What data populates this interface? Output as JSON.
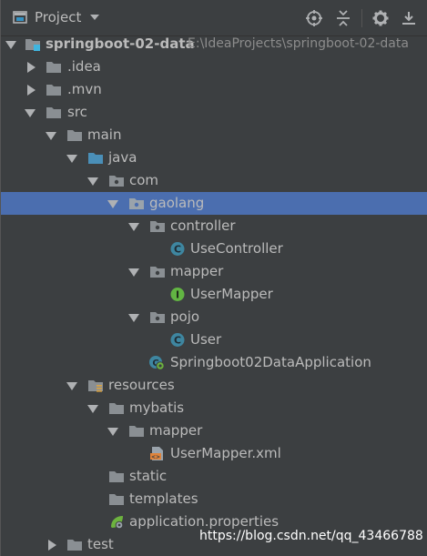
{
  "header": {
    "title": "Project",
    "tools": [
      "locate-icon",
      "collapse-icon",
      "gear-icon",
      "hide-icon"
    ]
  },
  "tree": [
    {
      "name": "project-root",
      "label": "springboot-02-data",
      "path": "E:\\IdeaProjects\\springboot-02-data",
      "expanded": true,
      "icon": "module-folder-icon"
    },
    {
      "name": "folder-idea",
      "label": ".idea",
      "expanded": false,
      "icon": "folder-icon"
    },
    {
      "name": "folder-mvn",
      "label": ".mvn",
      "expanded": false,
      "icon": "folder-icon"
    },
    {
      "name": "folder-src",
      "label": "src",
      "expanded": true,
      "icon": "folder-icon"
    },
    {
      "name": "folder-main",
      "label": "main",
      "expanded": true,
      "icon": "folder-icon"
    },
    {
      "name": "folder-java",
      "label": "java",
      "expanded": true,
      "icon": "source-folder-icon"
    },
    {
      "name": "package-com",
      "label": "com",
      "expanded": true,
      "icon": "package-icon"
    },
    {
      "name": "package-gaolang",
      "label": "gaolang",
      "expanded": true,
      "icon": "package-icon",
      "selected": true
    },
    {
      "name": "package-controller",
      "label": "controller",
      "expanded": true,
      "icon": "package-icon"
    },
    {
      "name": "class-usecontroller",
      "label": "UseController",
      "icon": "class-icon"
    },
    {
      "name": "package-mapper",
      "label": "mapper",
      "expanded": true,
      "icon": "package-icon"
    },
    {
      "name": "interface-usermapper",
      "label": "UserMapper",
      "icon": "interface-icon"
    },
    {
      "name": "package-pojo",
      "label": "pojo",
      "expanded": true,
      "icon": "package-icon"
    },
    {
      "name": "class-user",
      "label": "User",
      "icon": "class-icon"
    },
    {
      "name": "class-application",
      "label": "Springboot02DataApplication",
      "icon": "spring-boot-class-icon"
    },
    {
      "name": "folder-resources",
      "label": "resources",
      "expanded": true,
      "icon": "resources-folder-icon"
    },
    {
      "name": "folder-mybatis",
      "label": "mybatis",
      "expanded": true,
      "icon": "folder-icon"
    },
    {
      "name": "folder-mapper-xml",
      "label": "mapper",
      "expanded": true,
      "icon": "folder-icon"
    },
    {
      "name": "file-usermapper-xml",
      "label": "UserMapper.xml",
      "icon": "xml-file-icon"
    },
    {
      "name": "folder-static",
      "label": "static",
      "icon": "folder-icon"
    },
    {
      "name": "folder-templates",
      "label": "templates",
      "icon": "folder-icon"
    },
    {
      "name": "file-application-properties",
      "label": "application.properties",
      "icon": "spring-properties-icon"
    },
    {
      "name": "folder-test",
      "label": "test",
      "expanded": false,
      "icon": "folder-icon"
    }
  ],
  "watermark": "https://blog.csdn.net/qq_43466788",
  "colors": {
    "background": "#3c3f41",
    "selection": "#4b6eaf",
    "folder": "#8a8f93",
    "class": "#3e86a0",
    "interface": "#62b543"
  }
}
